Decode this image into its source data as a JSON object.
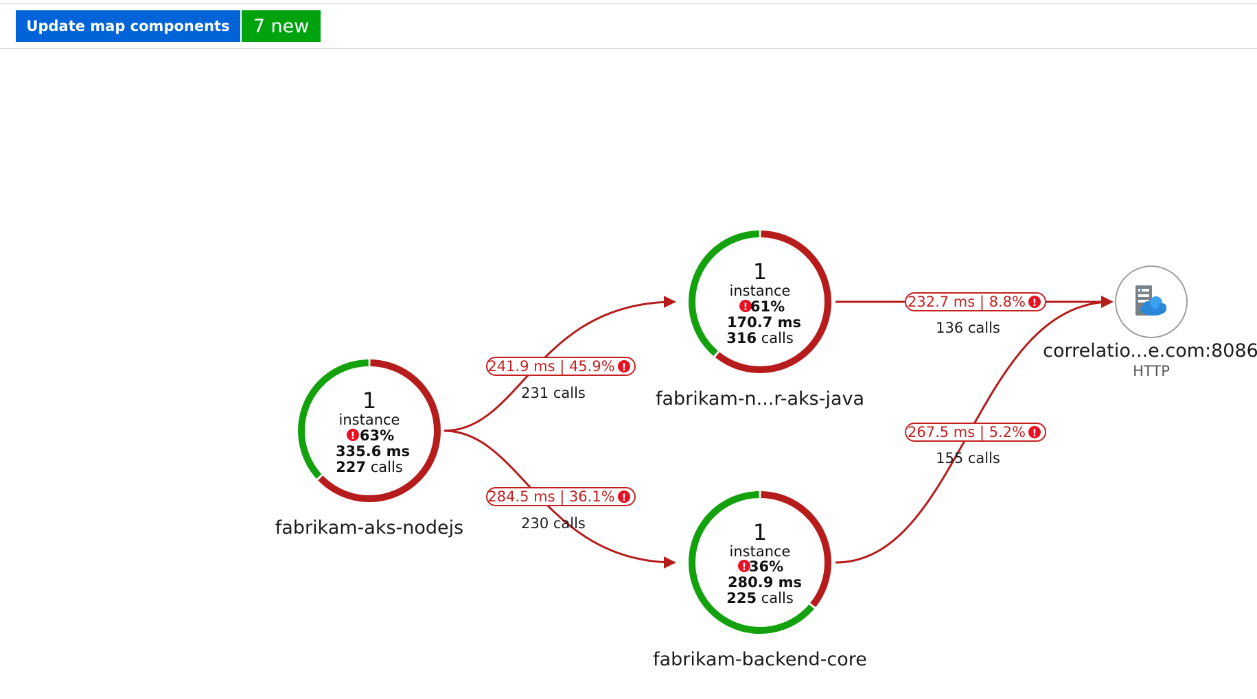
{
  "toolbar": {
    "update_label": "Update map components",
    "new_badge": "7 new"
  },
  "colors": {
    "healthy": "#13a10e",
    "failed": "#b71c1c",
    "button": "#0063d8",
    "badge": "#00a30e"
  },
  "nodes": {
    "nodejs": {
      "instances": "1",
      "instance_label": "instance",
      "failed_pct": "63%",
      "failed_fraction": 0.63,
      "duration": "335.6 ms",
      "calls_count": "227",
      "calls_word": "calls",
      "name": "fabrikam-aks-nodejs"
    },
    "java": {
      "instances": "1",
      "instance_label": "instance",
      "failed_pct": "61%",
      "failed_fraction": 0.61,
      "duration": "170.7 ms",
      "calls_count": "316",
      "calls_word": "calls",
      "name": "fabrikam-n...r-aks-java"
    },
    "core": {
      "instances": "1",
      "instance_label": "instance",
      "failed_pct": "36%",
      "failed_fraction": 0.36,
      "duration": "280.9 ms",
      "calls_count": "225",
      "calls_word": "calls",
      "name": "fabrikam-backend-core"
    },
    "http": {
      "name": "correlatio...e.com:8086",
      "type": "HTTP",
      "icon": "cloud-server-icon"
    }
  },
  "edges": {
    "nodejs_java": {
      "metrics": "241.9 ms | 45.9%",
      "calls": "231 calls"
    },
    "nodejs_core": {
      "metrics": "284.5 ms | 36.1%",
      "calls": "230 calls"
    },
    "java_http": {
      "metrics": "232.7 ms | 8.8%",
      "calls": "136 calls"
    },
    "core_http": {
      "metrics": "267.5 ms | 5.2%",
      "calls": "155 calls"
    }
  }
}
